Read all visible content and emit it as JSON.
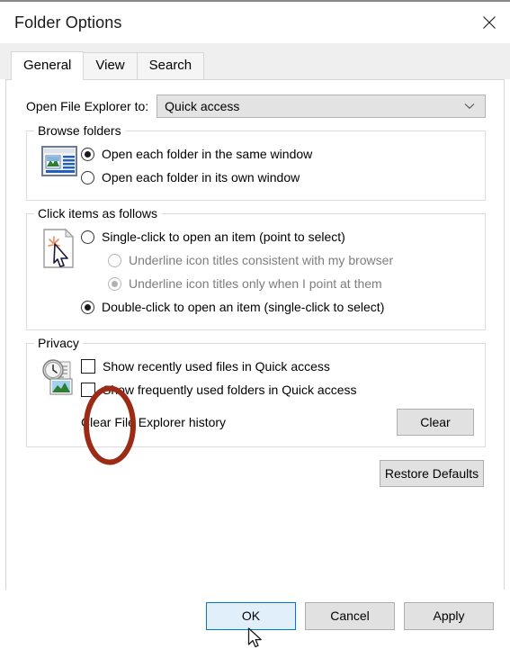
{
  "window": {
    "title": "Folder Options",
    "close_icon": "close-icon"
  },
  "tabs": [
    {
      "label": "General",
      "active": true
    },
    {
      "label": "View",
      "active": false
    },
    {
      "label": "Search",
      "active": false
    }
  ],
  "general": {
    "open_file_explorer": {
      "label": "Open File Explorer to:",
      "value": "Quick access",
      "chevron_icon": "chevron-down-icon"
    },
    "browse_folders": {
      "title": "Browse folders",
      "icon": "folder-window-icon",
      "options": [
        {
          "label": "Open each folder in the same window",
          "checked": true,
          "disabled": false
        },
        {
          "label": "Open each folder in its own window",
          "checked": false,
          "disabled": false
        }
      ]
    },
    "click_items": {
      "title": "Click items as follows",
      "icon": "click-document-cursor-icon",
      "options": [
        {
          "label": "Single-click to open an item (point to select)",
          "checked": false,
          "disabled": false,
          "indent": false
        },
        {
          "label": "Underline icon titles consistent with my browser",
          "checked": false,
          "disabled": true,
          "indent": true
        },
        {
          "label": "Underline icon titles only when I point at them",
          "checked": true,
          "disabled": true,
          "indent": true
        },
        {
          "label": "Double-click to open an item (single-click to select)",
          "checked": true,
          "disabled": false,
          "indent": false
        }
      ]
    },
    "privacy": {
      "title": "Privacy",
      "icon": "clock-history-icon",
      "checkboxes": [
        {
          "label": "Show recently used files in Quick access",
          "checked": false
        },
        {
          "label": "Show frequently used folders in Quick access",
          "checked": false
        }
      ],
      "clear_history_label": "Clear File Explorer history",
      "clear_button": "Clear"
    },
    "restore_defaults_button": "Restore Defaults"
  },
  "footer": {
    "ok": "OK",
    "cancel": "Cancel",
    "apply": "Apply"
  },
  "annotation": {
    "shape": "ellipse-highlight",
    "color": "#9c2b16"
  },
  "colors": {
    "accent": "#0078d7",
    "button_face": "#e1e1e1",
    "dialog_bg": "#ffffff",
    "tabstrip_bg": "#efefef",
    "annotation_red": "#9c2b16"
  }
}
